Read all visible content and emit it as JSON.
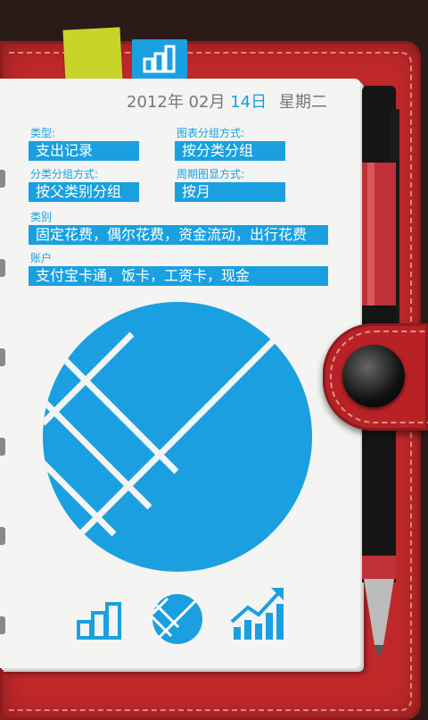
{
  "date": {
    "year": "2012",
    "year_suffix": "年",
    "month": "02月",
    "day": "14日",
    "weekday": "星期二"
  },
  "form": {
    "type_label": "类型:",
    "type_value": "支出记录",
    "chart_group_label": "图表分组方式:",
    "chart_group_value": "按分类分组",
    "category_group_label": "分类分组方式:",
    "category_group_value": "按父类别分组",
    "period_label": "周期图显方式:",
    "period_value": "按月",
    "category_label": "类别",
    "category_value": "固定花费，偶尔花费，资金流动，出行花费",
    "account_label": "账户",
    "account_value": "支付宝卡通，饭卡，工资卡，现金"
  },
  "colors": {
    "accent": "#1aa0e0",
    "binder": "#c0282a"
  },
  "icons": [
    "bar-chart-icon",
    "pie-chart-icon",
    "line-trend-icon"
  ]
}
